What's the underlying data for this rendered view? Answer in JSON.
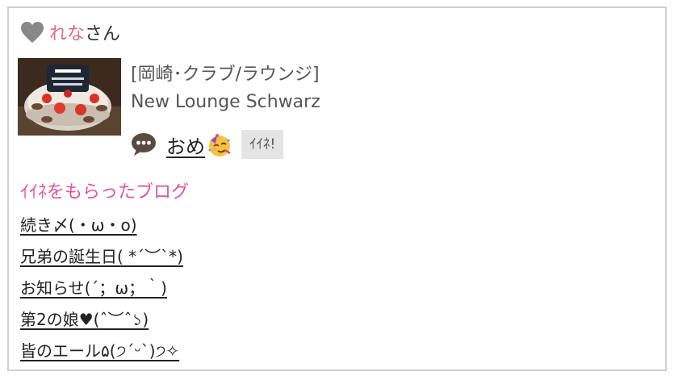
{
  "user": {
    "icon": "heart-icon",
    "name": "れな",
    "suffix": "さん"
  },
  "shop": {
    "category": "[岡崎･クラブ/ラウンジ]",
    "name": "New Lounge Schwarz"
  },
  "comment": {
    "icon": "speech-bubble-icon",
    "text": "おめ",
    "emoji": "partying-face-emoji",
    "iine_label": "ｲｲﾈ!"
  },
  "liked_blogs": {
    "title": "ｲｲﾈをもらったブログ",
    "items": [
      "続き〆(・ω・o)",
      "兄弟の誕生日( *´︶`*)",
      "お知らせ(´；ω；｀)",
      "第2の娘♥(ˆ︶ˆ১)",
      "皆のエール۵(੭ˊᵕˋ)੭✧"
    ]
  },
  "colors": {
    "name_accent": "#e06a8a",
    "section_title": "#e0559a",
    "heart_gray": "#888888",
    "border": "#cfcfcf",
    "button_bg": "#e4e4e4"
  }
}
